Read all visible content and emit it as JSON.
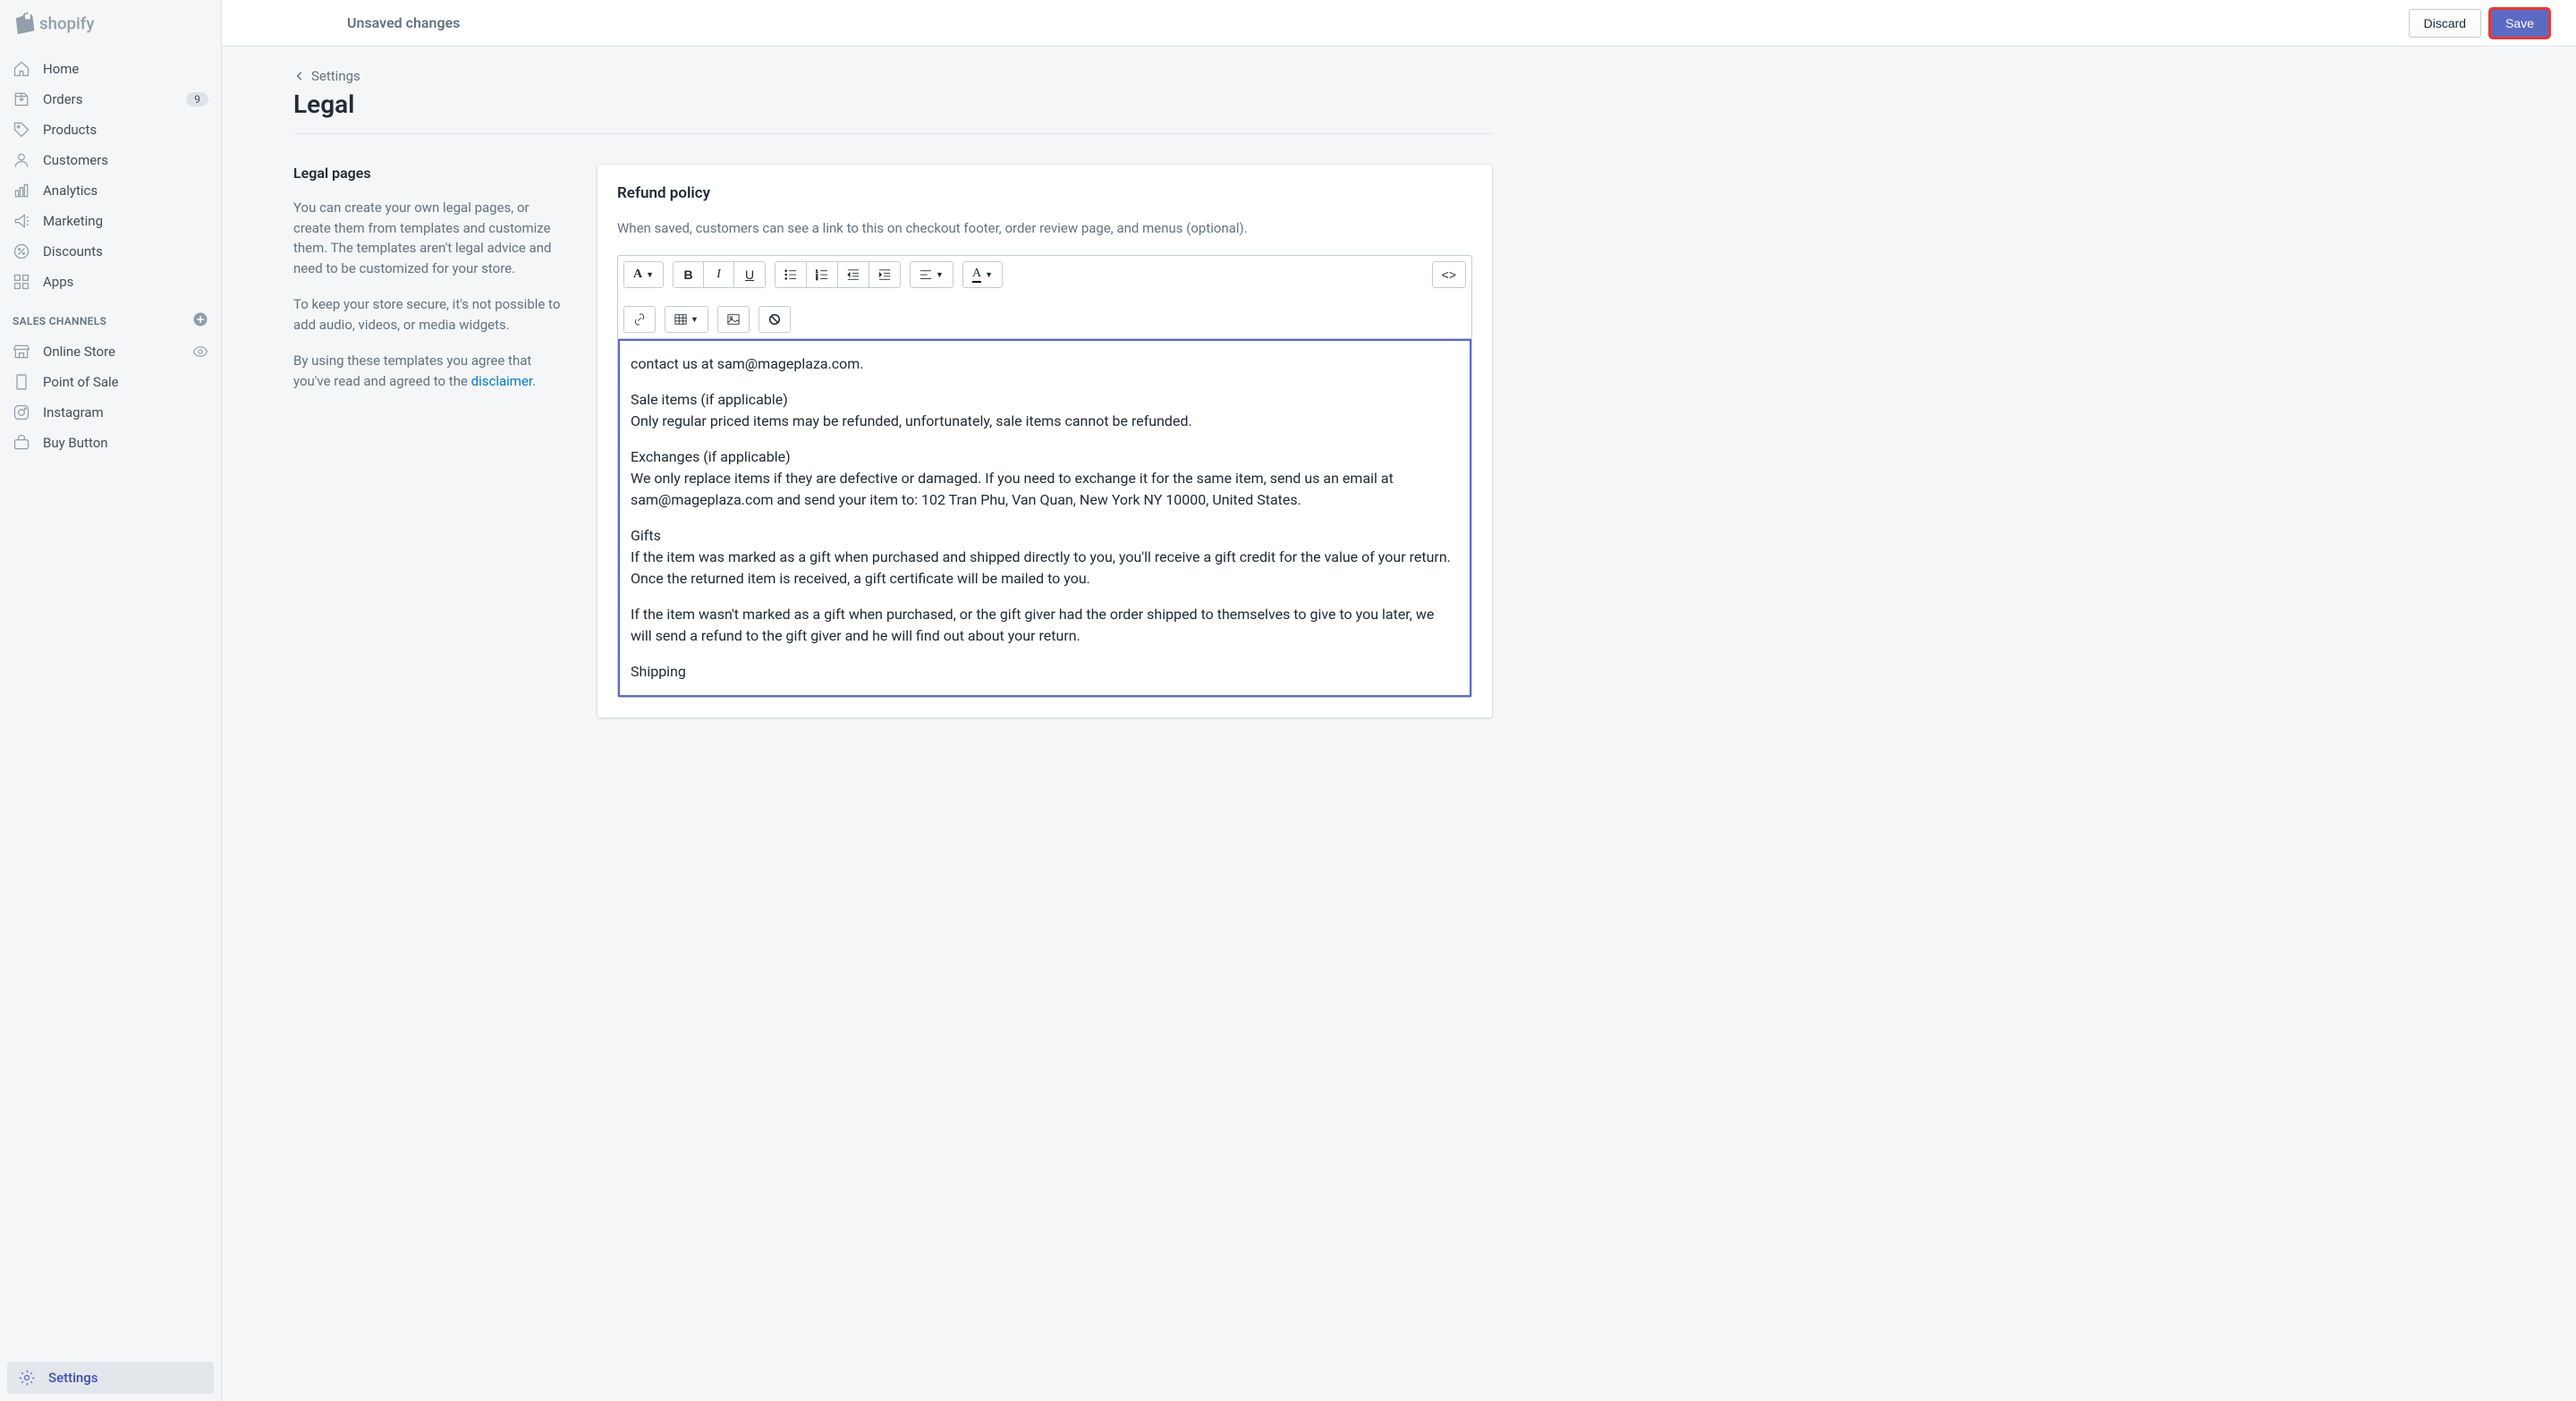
{
  "topbar": {
    "logo_text": "shopify",
    "status": "Unsaved changes",
    "discard_label": "Discard",
    "save_label": "Save"
  },
  "sidebar": {
    "items": [
      {
        "label": "Home",
        "icon": "home"
      },
      {
        "label": "Orders",
        "icon": "orders",
        "badge": "9"
      },
      {
        "label": "Products",
        "icon": "products"
      },
      {
        "label": "Customers",
        "icon": "customers"
      },
      {
        "label": "Analytics",
        "icon": "analytics"
      },
      {
        "label": "Marketing",
        "icon": "marketing"
      },
      {
        "label": "Discounts",
        "icon": "discounts"
      },
      {
        "label": "Apps",
        "icon": "apps"
      }
    ],
    "channels_header": "SALES CHANNELS",
    "channels": [
      {
        "label": "Online Store",
        "icon": "store",
        "eye": true
      },
      {
        "label": "Point of Sale",
        "icon": "pos"
      },
      {
        "label": "Instagram",
        "icon": "instagram"
      },
      {
        "label": "Buy Button",
        "icon": "buy"
      }
    ],
    "settings_label": "Settings"
  },
  "breadcrumb": {
    "label": "Settings"
  },
  "page": {
    "title": "Legal"
  },
  "legal_section": {
    "heading": "Legal pages",
    "para1": "You can create your own legal pages, or create them from templates and customize them. The templates aren't legal advice and need to be customized for your store.",
    "para2": "To keep your store secure, it's not possible to add audio, videos, or media widgets.",
    "para3_pre": "By using these templates you agree that you've read and agreed to the ",
    "disclaimer": "disclaimer",
    "para3_post": "."
  },
  "refund_card": {
    "title": "Refund policy",
    "subtitle": "When saved, customers can see a link to this on checkout footer, order review page, and menus (optional).",
    "content": {
      "line1": "contact us at sam@mageplaza.com.",
      "line2": "Sale items (if applicable)",
      "line3": "Only regular priced items may be refunded, unfortunately, sale items cannot be refunded.",
      "line4": "Exchanges (if applicable)",
      "line5": "We only replace items if they are defective or damaged. If you need to exchange it for the same item, send us an email at sam@mageplaza.com and send your item to: 102 Tran Phu, Van Quan, New York NY 10000, United States.",
      "line6": "Gifts",
      "line7": "If the item was marked as a gift when purchased and shipped directly to you, you'll receive a gift credit for the value of your return. Once the returned item is received, a gift certificate will be mailed to you.",
      "line8": "If the item wasn't marked as a gift when purchased, or the gift giver had the order shipped to themselves to give to you later, we will send a refund to the gift giver and he will find out about your return.",
      "line9": "Shipping"
    }
  }
}
